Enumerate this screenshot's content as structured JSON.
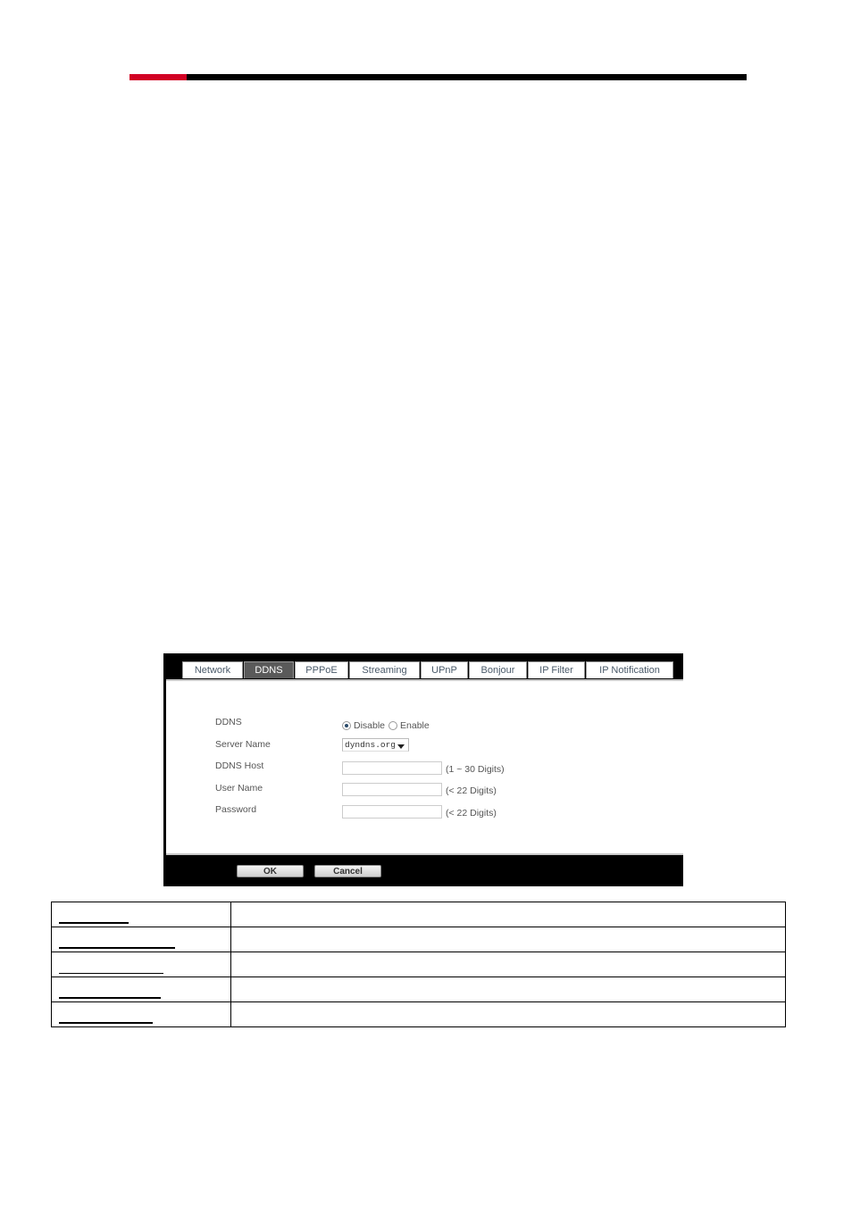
{
  "header": {
    "accent_color": "#d20024",
    "bar_color": "#000000"
  },
  "screenshot": {
    "tabs": [
      {
        "label": "Network",
        "active": false
      },
      {
        "label": "DDNS",
        "active": true
      },
      {
        "label": "PPPoE",
        "active": false
      },
      {
        "label": "Streaming",
        "active": false
      },
      {
        "label": "UPnP",
        "active": false
      },
      {
        "label": "Bonjour",
        "active": false
      },
      {
        "label": "IP Filter",
        "active": false
      },
      {
        "label": "IP Notification",
        "active": false
      }
    ],
    "form": {
      "ddns_label": "DDNS",
      "ddns_options": [
        {
          "label": "Disable",
          "selected": true
        },
        {
          "label": "Enable",
          "selected": false
        }
      ],
      "server_name_label": "Server Name",
      "server_name_value": "dyndns.org",
      "ddns_host_label": "DDNS Host",
      "ddns_host_value": "",
      "ddns_host_hint": "(1 ~ 30 Digits)",
      "user_name_label": "User Name",
      "user_name_value": "",
      "user_name_hint": "(< 22 Digits)",
      "password_label": "Password",
      "password_value": "",
      "password_hint": "(< 22 Digits)"
    },
    "buttons": {
      "ok": "OK",
      "cancel": "Cancel"
    }
  },
  "table": {
    "rows": [
      {
        "term": "",
        "description": ""
      },
      {
        "term": "",
        "description": ""
      },
      {
        "term": "",
        "description": ""
      },
      {
        "term": "",
        "description": ""
      },
      {
        "term": "",
        "description": ""
      }
    ]
  }
}
